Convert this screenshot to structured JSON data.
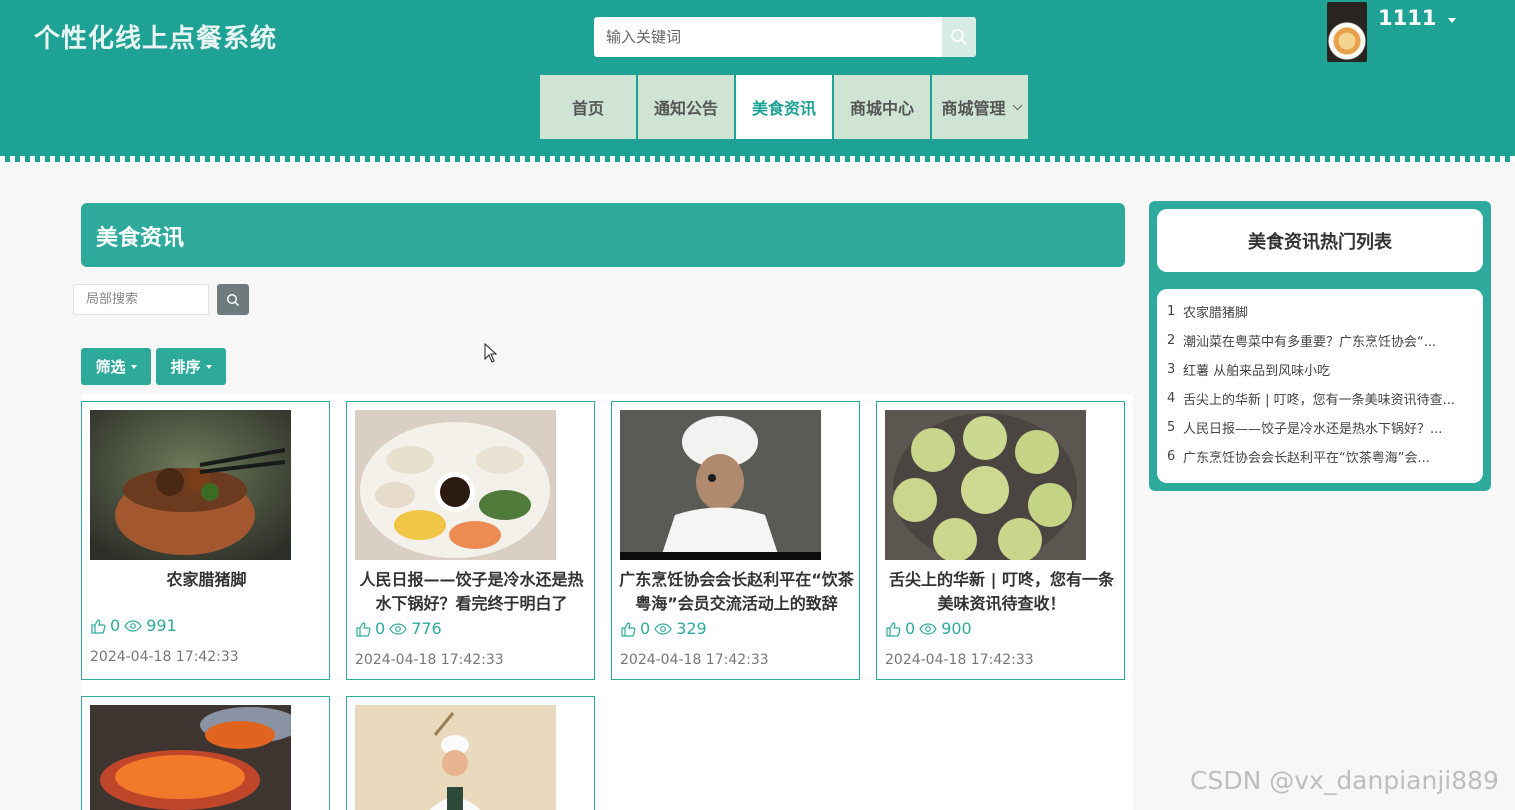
{
  "header": {
    "site_title": "个性化线上点餐系统",
    "search_placeholder": "输入关键词",
    "user_name": "1111",
    "nav": [
      {
        "label": "首页"
      },
      {
        "label": "通知公告"
      },
      {
        "label": "美食资讯",
        "active": true
      },
      {
        "label": "商城中心"
      },
      {
        "label": "商城管理",
        "dropdown": true
      }
    ]
  },
  "main": {
    "section_title": "美食资讯",
    "local_search_placeholder": "局部搜索",
    "filter_label": "筛选",
    "sort_label": "排序",
    "articles": [
      {
        "title": "农家腊猪脚",
        "likes": "0",
        "views": "991",
        "date": "2024-04-18 17:42:33",
        "image": "braised-pork-trotter-clay-pot"
      },
      {
        "title": "人民日报——饺子是冷水还是热水下锅好？看完终于明白了",
        "likes": "0",
        "views": "776",
        "date": "2024-04-18 17:42:33",
        "image": "dumplings-plate"
      },
      {
        "title": "广东烹饪协会会长赵利平在“饮茶粤海”会员交流活动上的致辞",
        "likes": "0",
        "views": "329",
        "date": "2024-04-18 17:42:33",
        "image": "chef-portrait"
      },
      {
        "title": "舌尖上的华新 | 叮咚，您有一条美味资讯待查收！",
        "likes": "0",
        "views": "900",
        "date": "2024-04-18 17:42:33",
        "image": "fried-patties-pan"
      },
      {
        "title": "",
        "image": "roasted-sweet-potato"
      },
      {
        "title": "",
        "image": "chef-cartoon"
      }
    ]
  },
  "sidebar": {
    "title": "美食资讯热门列表",
    "items": [
      {
        "num": "1",
        "text": "农家腊猪脚"
      },
      {
        "num": "2",
        "text": "潮汕菜在粤菜中有多重要？广东烹饪协会“..."
      },
      {
        "num": "3",
        "text": "红薯 从舶来品到风味小吃"
      },
      {
        "num": "4",
        "text": "舌尖上的华新 | 叮咚，您有一条美味资讯待查..."
      },
      {
        "num": "5",
        "text": "人民日报——饺子是冷水还是热水下锅好？..."
      },
      {
        "num": "6",
        "text": "广东烹饪协会会长赵利平在“饮茶粤海”会..."
      }
    ]
  },
  "watermark": "CSDN @vx_danpianji889",
  "colors": {
    "primary": "#1fa296",
    "accent": "#2daa9c",
    "nav_bg": "#cfe4d3"
  }
}
